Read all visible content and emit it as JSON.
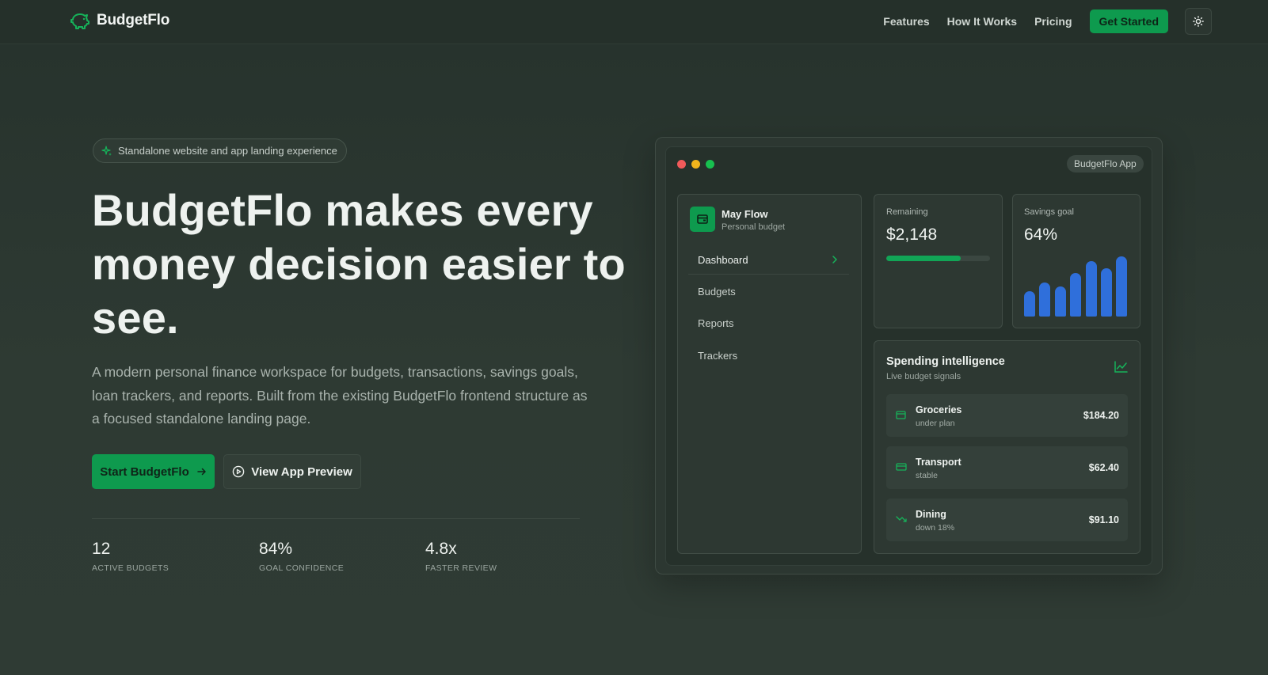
{
  "header": {
    "brand": "BudgetFlo",
    "nav": [
      "Features",
      "How It Works",
      "Pricing"
    ],
    "cta": "Get Started",
    "theme_icon": "sun-icon"
  },
  "hero": {
    "pill": "Standalone website and app landing experience",
    "title": "BudgetFlo makes every money decision easier to see.",
    "subtitle": "A modern personal finance workspace for budgets, transactions, savings goals, loan trackers, and reports. Built from the existing BudgetFlo frontend structure as a focused standalone landing page.",
    "primary_button": "Start BudgetFlo",
    "secondary_button": "View App Preview",
    "stats": [
      {
        "value": "12",
        "label": "ACTIVE BUDGETS"
      },
      {
        "value": "84%",
        "label": "GOAL CONFIDENCE"
      },
      {
        "value": "4.8x",
        "label": "FASTER REVIEW"
      }
    ]
  },
  "preview": {
    "app_tag": "BudgetFlo App",
    "window_dots": [
      "#f05a5a",
      "#f2b51c",
      "#17c04f"
    ],
    "sidebar": {
      "title": "May Flow",
      "subtitle": "Personal budget",
      "items": [
        "Dashboard",
        "Budgets",
        "Reports",
        "Trackers"
      ],
      "active": "Dashboard"
    },
    "remaining": {
      "label": "Remaining",
      "value": "$2,148",
      "progress": 0.72
    },
    "savings": {
      "label": "Savings goal",
      "value": "64%",
      "bars": [
        0.42,
        0.56,
        0.5,
        0.73,
        0.92,
        0.8,
        1.0
      ]
    },
    "spending": {
      "title": "Spending intelligence",
      "subtitle": "Live budget signals",
      "rows": [
        {
          "name": "Groceries",
          "note": "under plan",
          "amount": "$184.20",
          "icon": "wallet-icon"
        },
        {
          "name": "Transport",
          "note": "stable",
          "amount": "$62.40",
          "icon": "card-icon"
        },
        {
          "name": "Dining",
          "note": "down 18%",
          "amount": "$91.10",
          "icon": "trend-down-icon"
        }
      ]
    }
  },
  "colors": {
    "accent": "#0e9a4e",
    "bar": "#2f6fdb",
    "background": "#2b3731"
  }
}
